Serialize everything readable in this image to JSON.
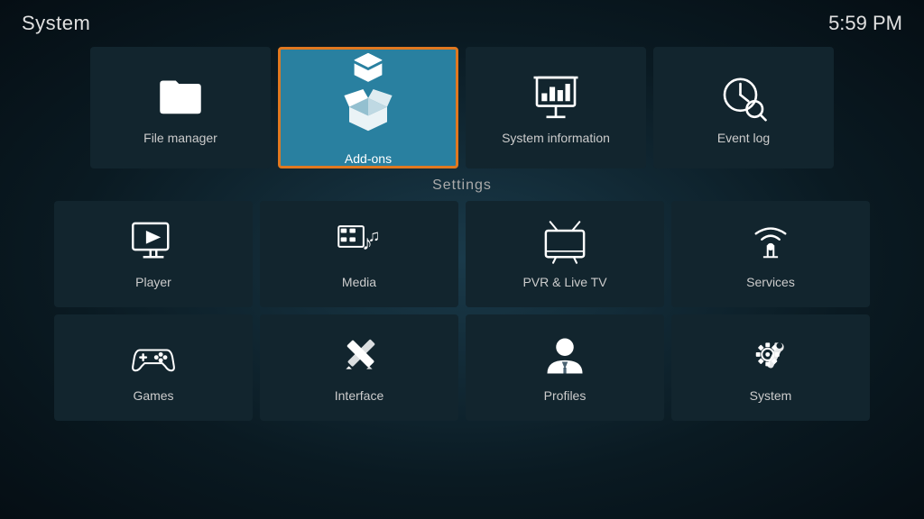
{
  "header": {
    "title": "System",
    "time": "5:59 PM"
  },
  "top_tiles": [
    {
      "id": "file-manager",
      "label": "File manager",
      "icon": "folder"
    },
    {
      "id": "add-ons",
      "label": "Add-ons",
      "icon": "box",
      "selected": true
    },
    {
      "id": "system-information",
      "label": "System information",
      "icon": "presentation"
    },
    {
      "id": "event-log",
      "label": "Event log",
      "icon": "clock-search"
    }
  ],
  "settings_section": {
    "label": "Settings"
  },
  "settings_tiles": [
    {
      "id": "player",
      "label": "Player",
      "icon": "player"
    },
    {
      "id": "media",
      "label": "Media",
      "icon": "media"
    },
    {
      "id": "pvr-live-tv",
      "label": "PVR & Live TV",
      "icon": "tv"
    },
    {
      "id": "services",
      "label": "Services",
      "icon": "services"
    },
    {
      "id": "games",
      "label": "Games",
      "icon": "games"
    },
    {
      "id": "interface",
      "label": "Interface",
      "icon": "interface"
    },
    {
      "id": "profiles",
      "label": "Profiles",
      "icon": "profiles"
    },
    {
      "id": "system",
      "label": "System",
      "icon": "system-gear"
    }
  ]
}
